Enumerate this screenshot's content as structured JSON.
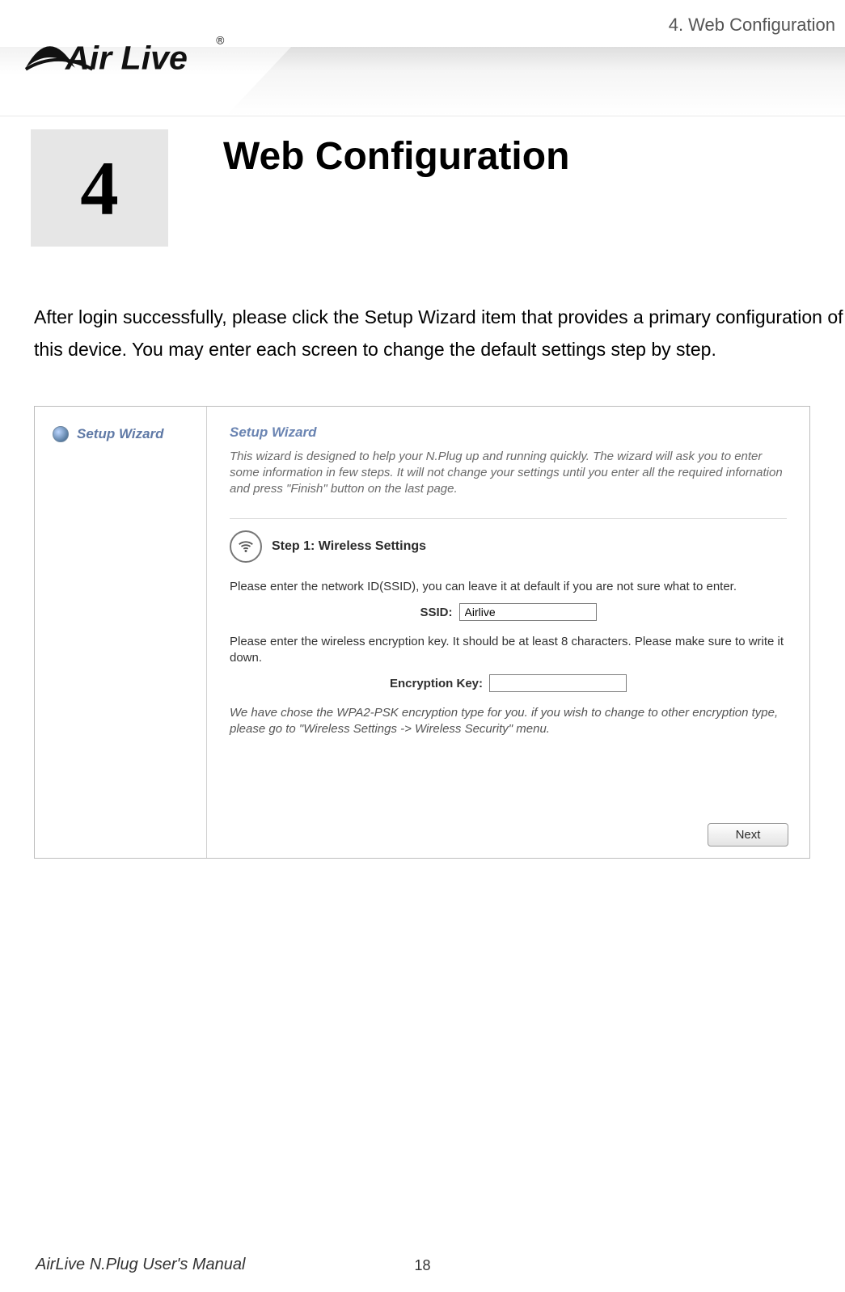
{
  "running_head": "4. Web Configuration",
  "logo_text": "Air Live",
  "logo_reg": "®",
  "chapter": {
    "number": "4",
    "title": "Web Configuration"
  },
  "intro": "After login successfully, please click the Setup Wizard item that provides a primary configuration of this device. You may enter each screen to change the default settings step by step.",
  "wizard": {
    "sidebar_item": "Setup Wizard",
    "title": "Setup Wizard",
    "description": "This wizard is designed to help your N.Plug up and running quickly. The wizard will ask you to enter some information in few steps. It will not change your settings until you enter all the required infornation and press \"Finish\" button on the last page.",
    "step_label": "Step 1: Wireless Settings",
    "ssid_prompt": "Please enter the network ID(SSID), you can leave it at default if you are not sure what to enter.",
    "ssid_label": "SSID:",
    "ssid_value": "Airlive",
    "key_prompt": "Please enter the wireless encryption key. It should be at least 8 characters. Please make sure to write it down.",
    "key_label": "Encryption Key:",
    "key_value": "",
    "note": "We have chose the WPA2-PSK encryption type for you.  if you wish to change to other encryption type, please go to \"Wireless Settings -> Wireless Security\" menu.",
    "next": "Next"
  },
  "footer": {
    "book": "AirLive N.Plug User's Manual",
    "page": "18"
  }
}
